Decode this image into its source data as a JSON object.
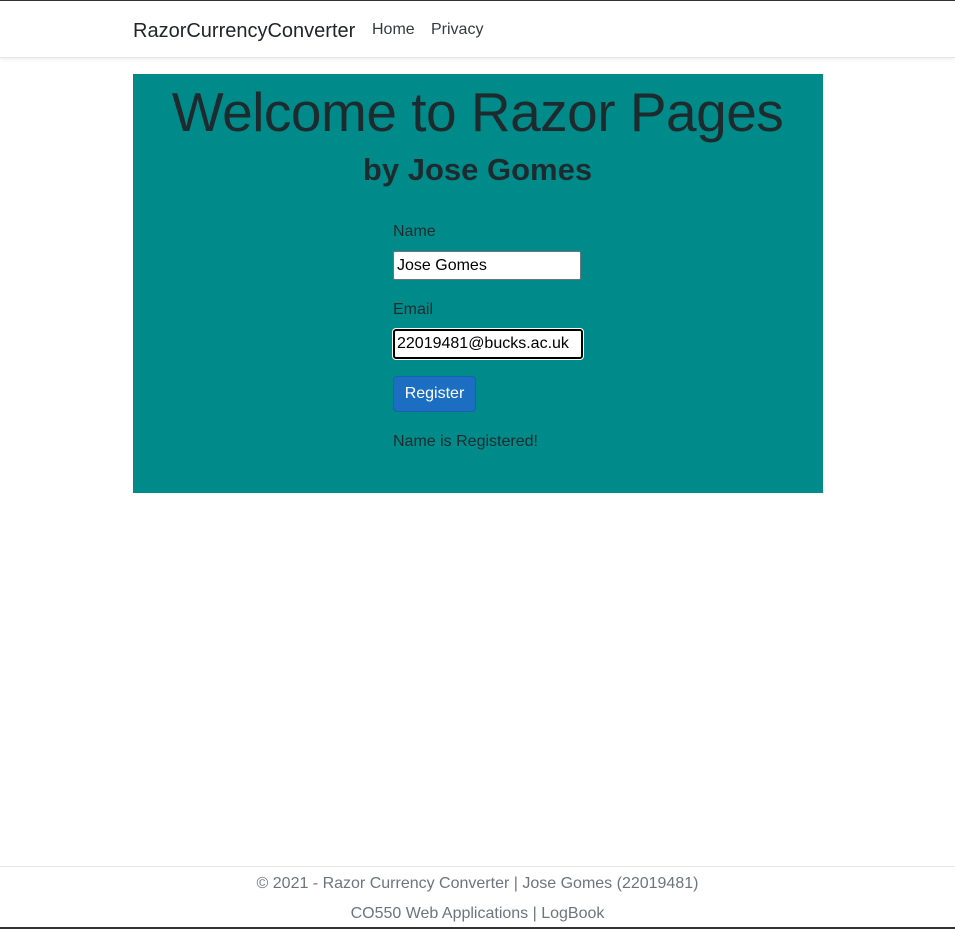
{
  "navbar": {
    "brand": "RazorCurrencyConverter",
    "links": [
      {
        "label": "Home"
      },
      {
        "label": "Privacy"
      }
    ]
  },
  "hero": {
    "title": "Welcome to Razor Pages",
    "subtitle": "by Jose Gomes",
    "background_color": "#008b8b"
  },
  "form": {
    "name_label": "Name",
    "name_value": "Jose Gomes",
    "email_label": "Email",
    "email_value": "22019481@bucks.ac.uk",
    "submit_label": "Register",
    "submit_color": "#1b6ec2",
    "status_message": "Name is Registered!"
  },
  "footer": {
    "copyright": "© 2021 - Razor Currency Converter | Jose Gomes (22019481)",
    "course_label": "CO550 Web Applications",
    "separator": "|",
    "logbook_label": "LogBook"
  }
}
